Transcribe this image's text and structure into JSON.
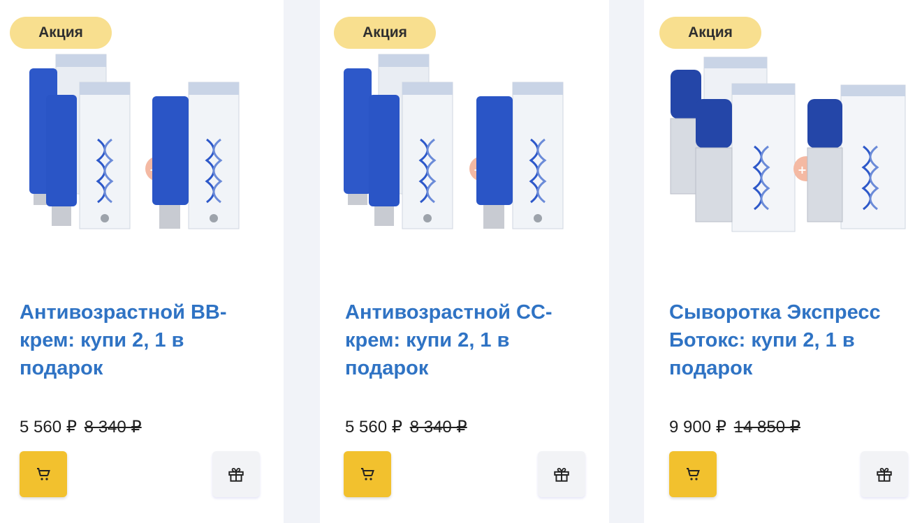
{
  "products": [
    {
      "badge": "Акция",
      "title": "Антивозрастной BB-крем: купи 2, 1 в подарок",
      "price": "5 560 ₽",
      "old_price": "8 340 ₽",
      "promo_mark": "+1"
    },
    {
      "badge": "Акция",
      "title": "Антивозрастной CC-крем: купи 2, 1 в подарок",
      "price": "5 560 ₽",
      "old_price": "8 340 ₽",
      "promo_mark": "+1"
    },
    {
      "badge": "Акция",
      "title": "Сыворотка Экспресс Ботокс: купи 2, 1 в подарок",
      "price": "9 900 ₽",
      "old_price": "14 850 ₽",
      "promo_mark": "+1"
    }
  ],
  "colors": {
    "badge_bg": "#f8df8f",
    "title": "#2f73c4",
    "cart_button": "#f2c12e",
    "gift_button": "#f2f3f6",
    "product_blue": "#2d58c9"
  },
  "icons": {
    "cart": "cart-icon",
    "gift": "gift-icon"
  }
}
